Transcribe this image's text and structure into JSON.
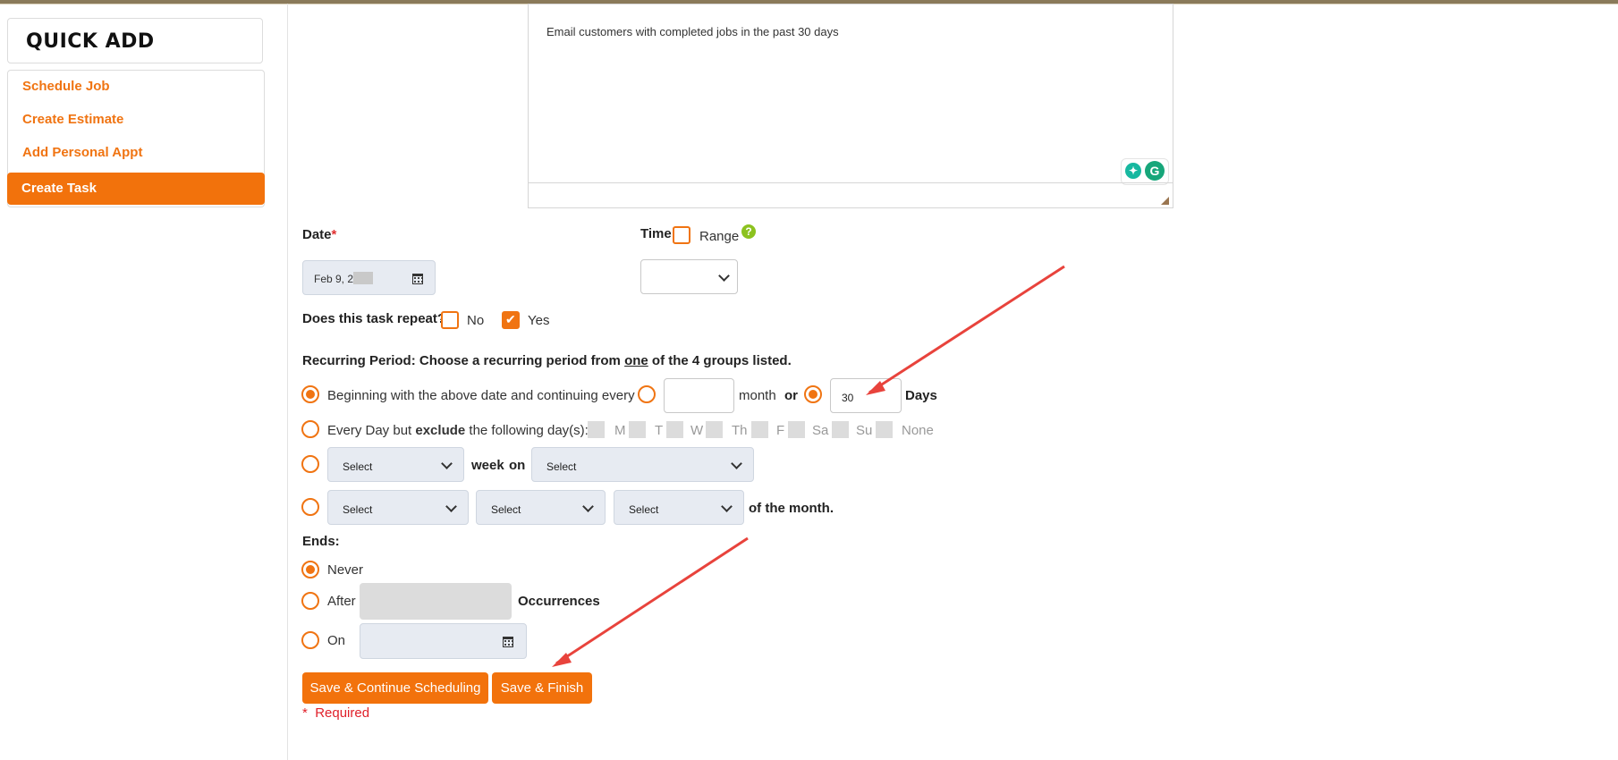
{
  "sidebar": {
    "title": "QUICK ADD",
    "items": [
      {
        "label": "Schedule Job",
        "active": false
      },
      {
        "label": "Create Estimate",
        "active": false
      },
      {
        "label": "Add Personal Appt",
        "active": false
      },
      {
        "label": "Create Task",
        "active": true
      }
    ]
  },
  "notes": {
    "text": "Email customers with completed jobs in the past 30 days"
  },
  "date": {
    "label": "Date",
    "required_mark": "*",
    "value": "Feb 9, 2"
  },
  "time": {
    "label": "Time",
    "range_label": "Range",
    "range_checked": false,
    "help_icon": "?"
  },
  "repeat": {
    "question": "Does this task repeat?",
    "no_label": "No",
    "yes_label": "Yes",
    "no_checked": false,
    "yes_checked": true
  },
  "recurring": {
    "label": "Recurring Period:",
    "desc_before": "Choose a recurring period from ",
    "desc_emph": "one",
    "desc_after": " of the 4 groups listed.",
    "option1": {
      "text": "Beginning with the above date and continuing every",
      "month_value": "",
      "month_label": "month",
      "or_label": "or",
      "days_value": "30",
      "days_label": "Days"
    },
    "option2": {
      "text_before": "Every Day but ",
      "text_emph": "exclude",
      "text_after": " the following day(s):",
      "days": [
        "M",
        "T",
        "W",
        "Th",
        "F",
        "Sa",
        "Su",
        "None"
      ]
    },
    "option3": {
      "select1": "Select",
      "week_label": "week",
      "on_label": "on",
      "select2": "Select"
    },
    "option4": {
      "select1": "Select",
      "select2": "Select",
      "select3": "Select",
      "suffix": "of the month."
    }
  },
  "ends": {
    "label": "Ends:",
    "never_label": "Never",
    "after_label": "After",
    "occurrences_label": "Occurrences",
    "on_label": "On"
  },
  "actions": {
    "save_continue": "Save & Continue Scheduling",
    "save_finish": "Save & Finish"
  },
  "footer": {
    "required_star": "*",
    "required_text": "Required"
  },
  "colors": {
    "accent": "#f2720c",
    "annotation_arrow": "#e8433c"
  }
}
